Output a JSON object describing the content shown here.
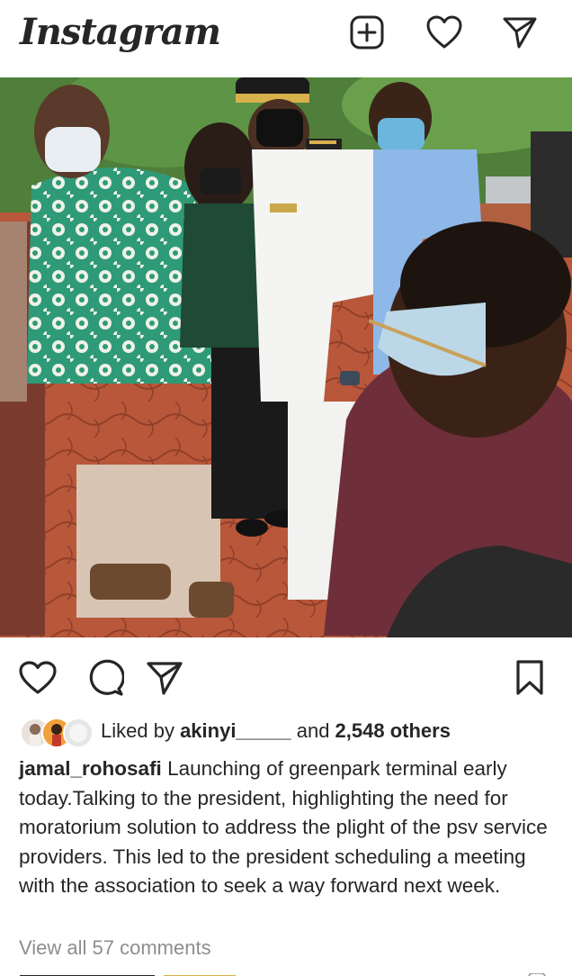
{
  "app": {
    "logo_text": "Instagram"
  },
  "header": {
    "icons": [
      "new-post-icon",
      "heart-icon",
      "direct-message-icon"
    ]
  },
  "post": {
    "image_description_icon": "photo",
    "actions": {
      "icons": [
        "heart-icon",
        "comment-icon",
        "share-icon",
        "bookmark-icon"
      ]
    },
    "likes": {
      "prefix": "Liked by ",
      "liker": "akinyi_____",
      "middle": " and ",
      "others": "2,548 others"
    },
    "caption": {
      "username": "jamal_rohosafi",
      "text": " Launching of greenpark terminal early today.Talking to the president, highlighting the need for moratorium solution to address the plight of the psv service providers. This led to the president scheduling a meeting with the association to seek a way forward next week."
    },
    "comments": {
      "view_all_label": "View all 57 comments"
    }
  },
  "colors": {
    "text": "#262626",
    "muted": "#8e8e8e",
    "background": "#ffffff"
  }
}
